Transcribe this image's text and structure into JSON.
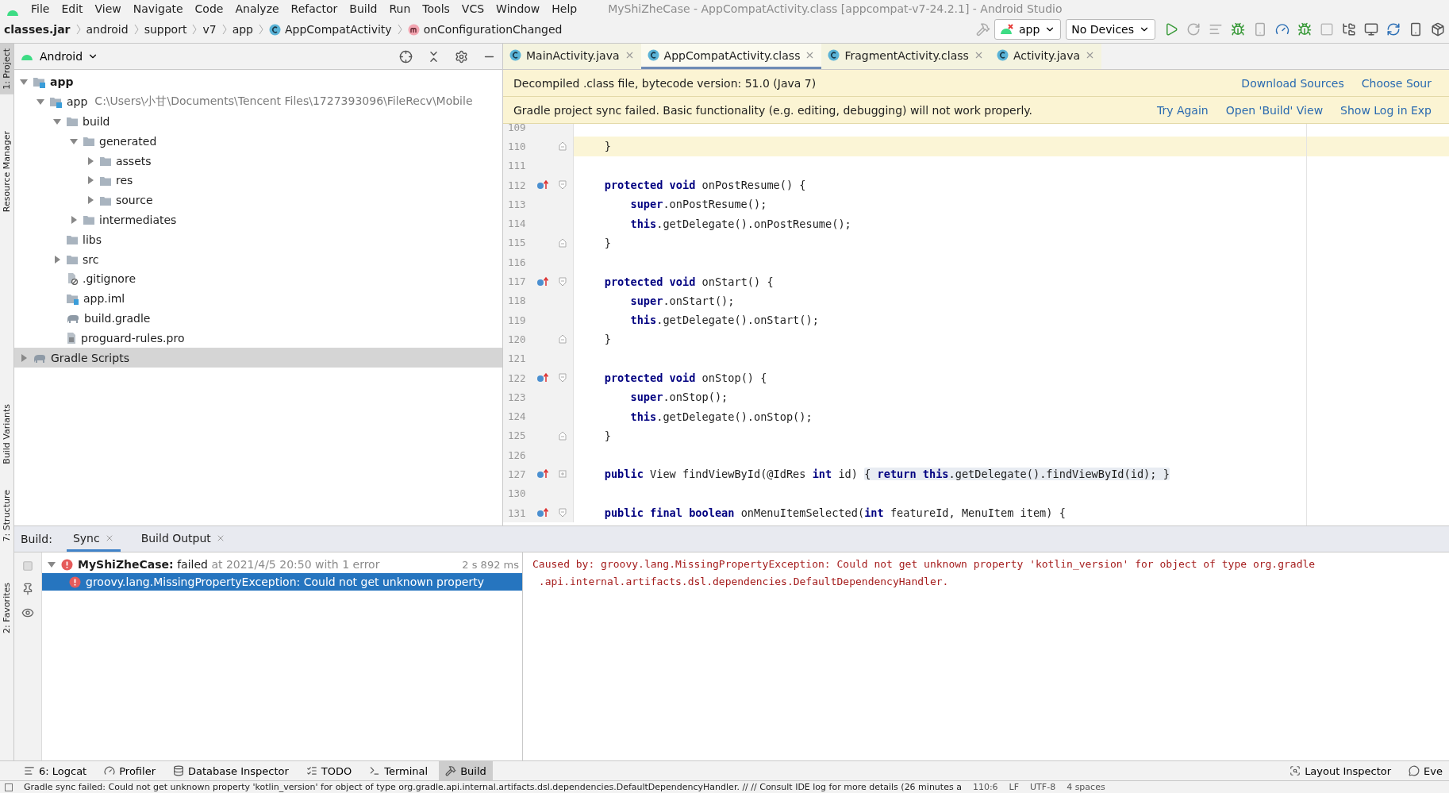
{
  "menu": [
    "File",
    "Edit",
    "View",
    "Navigate",
    "Code",
    "Analyze",
    "Refactor",
    "Build",
    "Run",
    "Tools",
    "VCS",
    "Window",
    "Help"
  ],
  "window": {
    "title": "MyShiZheCase - AppCompatActivity.class [appcompat-v7-24.2.1] - Android Studio"
  },
  "breadcrumbs": [
    {
      "label": "classes.jar",
      "kind": "jar"
    },
    {
      "label": "android",
      "kind": "package"
    },
    {
      "label": "support",
      "kind": "package"
    },
    {
      "label": "v7",
      "kind": "package"
    },
    {
      "label": "app",
      "kind": "package"
    },
    {
      "label": "AppCompatActivity",
      "kind": "class"
    },
    {
      "label": "onConfigurationChanged",
      "kind": "method"
    }
  ],
  "toolbar": {
    "run_config": "app",
    "device": "No Devices"
  },
  "left_stripe": [
    {
      "label": "1: Project",
      "selected": true
    },
    {
      "label": "Resource Manager",
      "selected": false
    },
    {
      "label": "Build Variants",
      "selected": false
    },
    {
      "label": "7: Structure",
      "selected": false
    },
    {
      "label": "2: Favorites",
      "selected": false
    }
  ],
  "project": {
    "view": "Android",
    "tree": [
      {
        "label": "app",
        "kind": "module",
        "bold": true,
        "expanded": true,
        "selected": false,
        "children": [
          {
            "label": "app",
            "kind": "module",
            "hint": "C:\\Users\\小甘\\Documents\\Tencent Files\\1727393096\\FileRecv\\Mobile",
            "expanded": true,
            "selected": false,
            "children": [
              {
                "label": "build",
                "kind": "folder",
                "expanded": true,
                "selected": false,
                "children": [
                  {
                    "label": "generated",
                    "kind": "folder",
                    "expanded": true,
                    "selected": false,
                    "children": [
                      {
                        "label": "assets",
                        "kind": "folder",
                        "expanded": false,
                        "selected": false
                      },
                      {
                        "label": "res",
                        "kind": "folder",
                        "expanded": false,
                        "selected": false
                      },
                      {
                        "label": "source",
                        "kind": "folder",
                        "expanded": false,
                        "selected": false
                      }
                    ]
                  },
                  {
                    "label": "intermediates",
                    "kind": "folder",
                    "expanded": false,
                    "selected": false
                  }
                ]
              },
              {
                "label": "libs",
                "kind": "folder",
                "selected": false
              },
              {
                "label": "src",
                "kind": "folder",
                "expanded": false,
                "selected": false
              },
              {
                "label": ".gitignore",
                "kind": "ignored",
                "selected": false
              },
              {
                "label": "app.iml",
                "kind": "module-file",
                "selected": false
              },
              {
                "label": "build.gradle",
                "kind": "gradle",
                "selected": false
              },
              {
                "label": "proguard-rules.pro",
                "kind": "text",
                "selected": false
              }
            ]
          }
        ]
      },
      {
        "label": "Gradle Scripts",
        "kind": "gradle",
        "expanded": false,
        "selected": true
      }
    ]
  },
  "editor": {
    "tabs": [
      {
        "label": "MainActivity.java",
        "selected": false
      },
      {
        "label": "AppCompatActivity.class",
        "selected": true
      },
      {
        "label": "FragmentActivity.class",
        "selected": false
      },
      {
        "label": "Activity.java",
        "selected": false
      }
    ],
    "banners": [
      {
        "text": "Decompiled .class file, bytecode version: 51.0 (Java 7)",
        "links": [
          "Download Sources",
          "Choose Sour"
        ]
      },
      {
        "text": "Gradle project sync failed. Basic functionality (e.g. editing, debugging) will not work properly.",
        "links": [
          "Try Again",
          "Open 'Build' View",
          "Show Log in Exp"
        ]
      }
    ],
    "lines": [
      {
        "number": "109",
        "kind": "plain",
        "current": false,
        "override": false
      },
      {
        "number": "110",
        "kind": "closing",
        "text": "    }",
        "current": true,
        "override": false
      },
      {
        "number": "111",
        "kind": "plain",
        "current": false,
        "override": false
      },
      {
        "number": "112",
        "kind": "opening",
        "text": "    **protected** **void** onPostResume() {",
        "current": false,
        "override": true
      },
      {
        "number": "113",
        "kind": "plain",
        "text": "        **super**.onPostResume();",
        "current": false,
        "override": false
      },
      {
        "number": "114",
        "kind": "plain",
        "text": "        **this**.getDelegate().onPostResume();",
        "current": false,
        "override": false
      },
      {
        "number": "115",
        "kind": "closing",
        "text": "    }",
        "current": false,
        "override": false
      },
      {
        "number": "116",
        "kind": "plain",
        "current": false,
        "override": false
      },
      {
        "number": "117",
        "kind": "opening",
        "text": "    **protected** **void** onStart() {",
        "current": false,
        "override": true
      },
      {
        "number": "118",
        "kind": "plain",
        "text": "        **super**.onStart();",
        "current": false,
        "override": false
      },
      {
        "number": "119",
        "kind": "plain",
        "text": "        **this**.getDelegate().onStart();",
        "current": false,
        "override": false
      },
      {
        "number": "120",
        "kind": "closing",
        "text": "    }",
        "current": false,
        "override": false
      },
      {
        "number": "121",
        "kind": "plain",
        "current": false,
        "override": false
      },
      {
        "number": "122",
        "kind": "opening",
        "text": "    **protected** **void** onStop() {",
        "current": false,
        "override": true
      },
      {
        "number": "123",
        "kind": "plain",
        "text": "        **super**.onStop();",
        "current": false,
        "override": false
      },
      {
        "number": "124",
        "kind": "plain",
        "text": "        **this**.getDelegate().onStop();",
        "current": false,
        "override": false
      },
      {
        "number": "125",
        "kind": "closing",
        "text": "    }",
        "current": false,
        "override": false
      },
      {
        "number": "126",
        "kind": "plain",
        "current": false,
        "override": false
      },
      {
        "number": "127",
        "kind": "collapsed",
        "text": "    **public** View findViewById(@IdRes **int** id) ",
        "folded": "{ **return** **this**.getDelegate().findViewById(id); }",
        "current": false,
        "override": true
      },
      {
        "number": "130",
        "kind": "plain",
        "current": false,
        "override": false
      },
      {
        "number": "131",
        "kind": "opening",
        "text": "    **public** **final** **boolean** onMenuItemSelected(**int** featureId, MenuItem item) {",
        "current": false,
        "override": true
      }
    ]
  },
  "build": {
    "label": "Build:",
    "tabs": [
      {
        "label": "Sync",
        "selected": true
      },
      {
        "label": "Build Output",
        "selected": false
      }
    ],
    "tree": [
      {
        "name": "MyShiZheCase:",
        "status": "failed",
        "detail": "at 2021/4/5 20:50 with 1 error",
        "time": "2 s 892 ms",
        "expanded": true,
        "selected": false,
        "children": [
          {
            "name": "groovy.lang.MissingPropertyException: Could not get unknown property",
            "selected": true
          }
        ]
      }
    ],
    "console": [
      "Caused by: groovy.lang.MissingPropertyException: Could not get unknown property 'kotlin_version' for object of type org.gradle",
      ".api.internal.artifacts.dsl.dependencies.DefaultDependencyHandler."
    ]
  },
  "tool_windows": [
    {
      "label": "6: Logcat",
      "kind": "logcat",
      "selected": false
    },
    {
      "label": "Profiler",
      "kind": "profiler",
      "selected": false
    },
    {
      "label": "Database Inspector",
      "kind": "database",
      "selected": false
    },
    {
      "label": "TODO",
      "kind": "todo",
      "selected": false
    },
    {
      "label": "Terminal",
      "kind": "terminal",
      "selected": false
    },
    {
      "label": "Build",
      "kind": "build",
      "selected": true
    }
  ],
  "tool_windows_right": [
    {
      "label": "Layout Inspector",
      "kind": "layout"
    },
    {
      "label": "Eve",
      "kind": "event"
    }
  ],
  "status_bar": {
    "message": "Gradle sync failed: Could not get unknown property 'kotlin_version' for object of type org.gradle.api.internal.artifacts.dsl.dependencies.DefaultDependencyHandler. // // Consult IDE log for more details (26 minutes a",
    "items": [
      "110:6",
      "LF",
      "UTF-8",
      "4 spaces"
    ]
  }
}
